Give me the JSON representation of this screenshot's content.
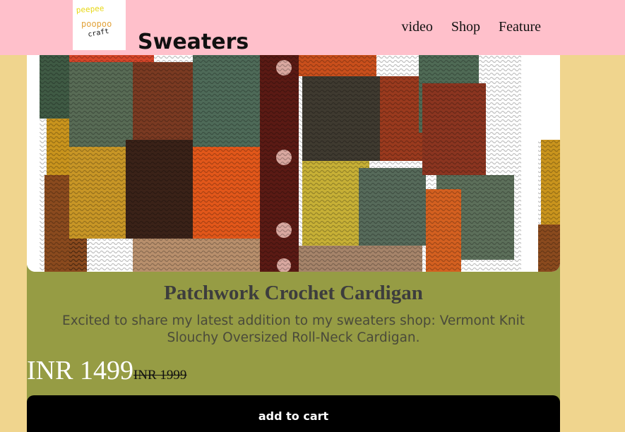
{
  "header": {
    "logo_text": [
      "peepee",
      "poopoo",
      "craft"
    ],
    "title": "Sweaters",
    "nav": [
      {
        "label": "video"
      },
      {
        "label": "Shop"
      },
      {
        "label": "Feature"
      }
    ]
  },
  "product": {
    "title": "Patchwork Crochet Cardigan",
    "description": "Excited to share my latest addition to my sweaters shop: Vermont Knit Slouchy Oversized Roll-Neck Cardigan.",
    "price": "INR 1499",
    "old_price": "INR 1999",
    "cta_label": "add to cart"
  },
  "colors": {
    "header_bg": "#ffc0cb",
    "page_bg": "#f0d58e",
    "card_bg": "#969c44",
    "button_bg": "#000000"
  }
}
